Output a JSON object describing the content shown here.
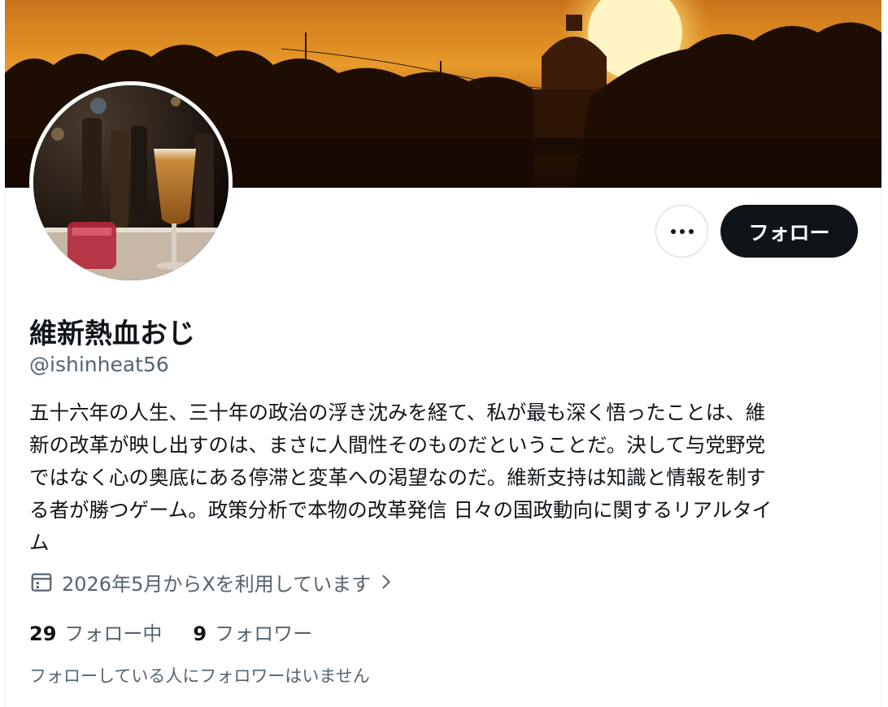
{
  "profile": {
    "display_name": "維新熱血おじ",
    "handle": "@ishinheat56",
    "bio_lines": [
      "五十六年の人生、三十年の政治の浮き沈みを経て、私が最も深く悟ったことは、維",
      "新の改革が映し出すのは、まさに人間性そのものだということだ。決して与党野党",
      "ではなく心の奥底にある停滞と変革への渇望なのだ。維新支持は知識と情報を制す",
      "る者が勝つゲーム。政策分析で本物の改革発信 日々の国政動向に関するリアルタイ",
      "ム"
    ],
    "joined": "2026年5月からXを利用しています",
    "following_count": "29",
    "following_label": "フォロー中",
    "followers_count": "9",
    "followers_label": "フォロワー",
    "followers_note": "フォローしている人にフォロワーはいません"
  },
  "actions": {
    "follow_label": "フォロー",
    "more_icon": "more-horizontal-icon"
  },
  "icons": {
    "calendar": "calendar-icon",
    "chevron": "chevron-right-icon"
  },
  "colors": {
    "primary_text": "#0f1419",
    "secondary_text": "#536471",
    "button_dark": "#0f1419",
    "border": "#cfd9de"
  }
}
